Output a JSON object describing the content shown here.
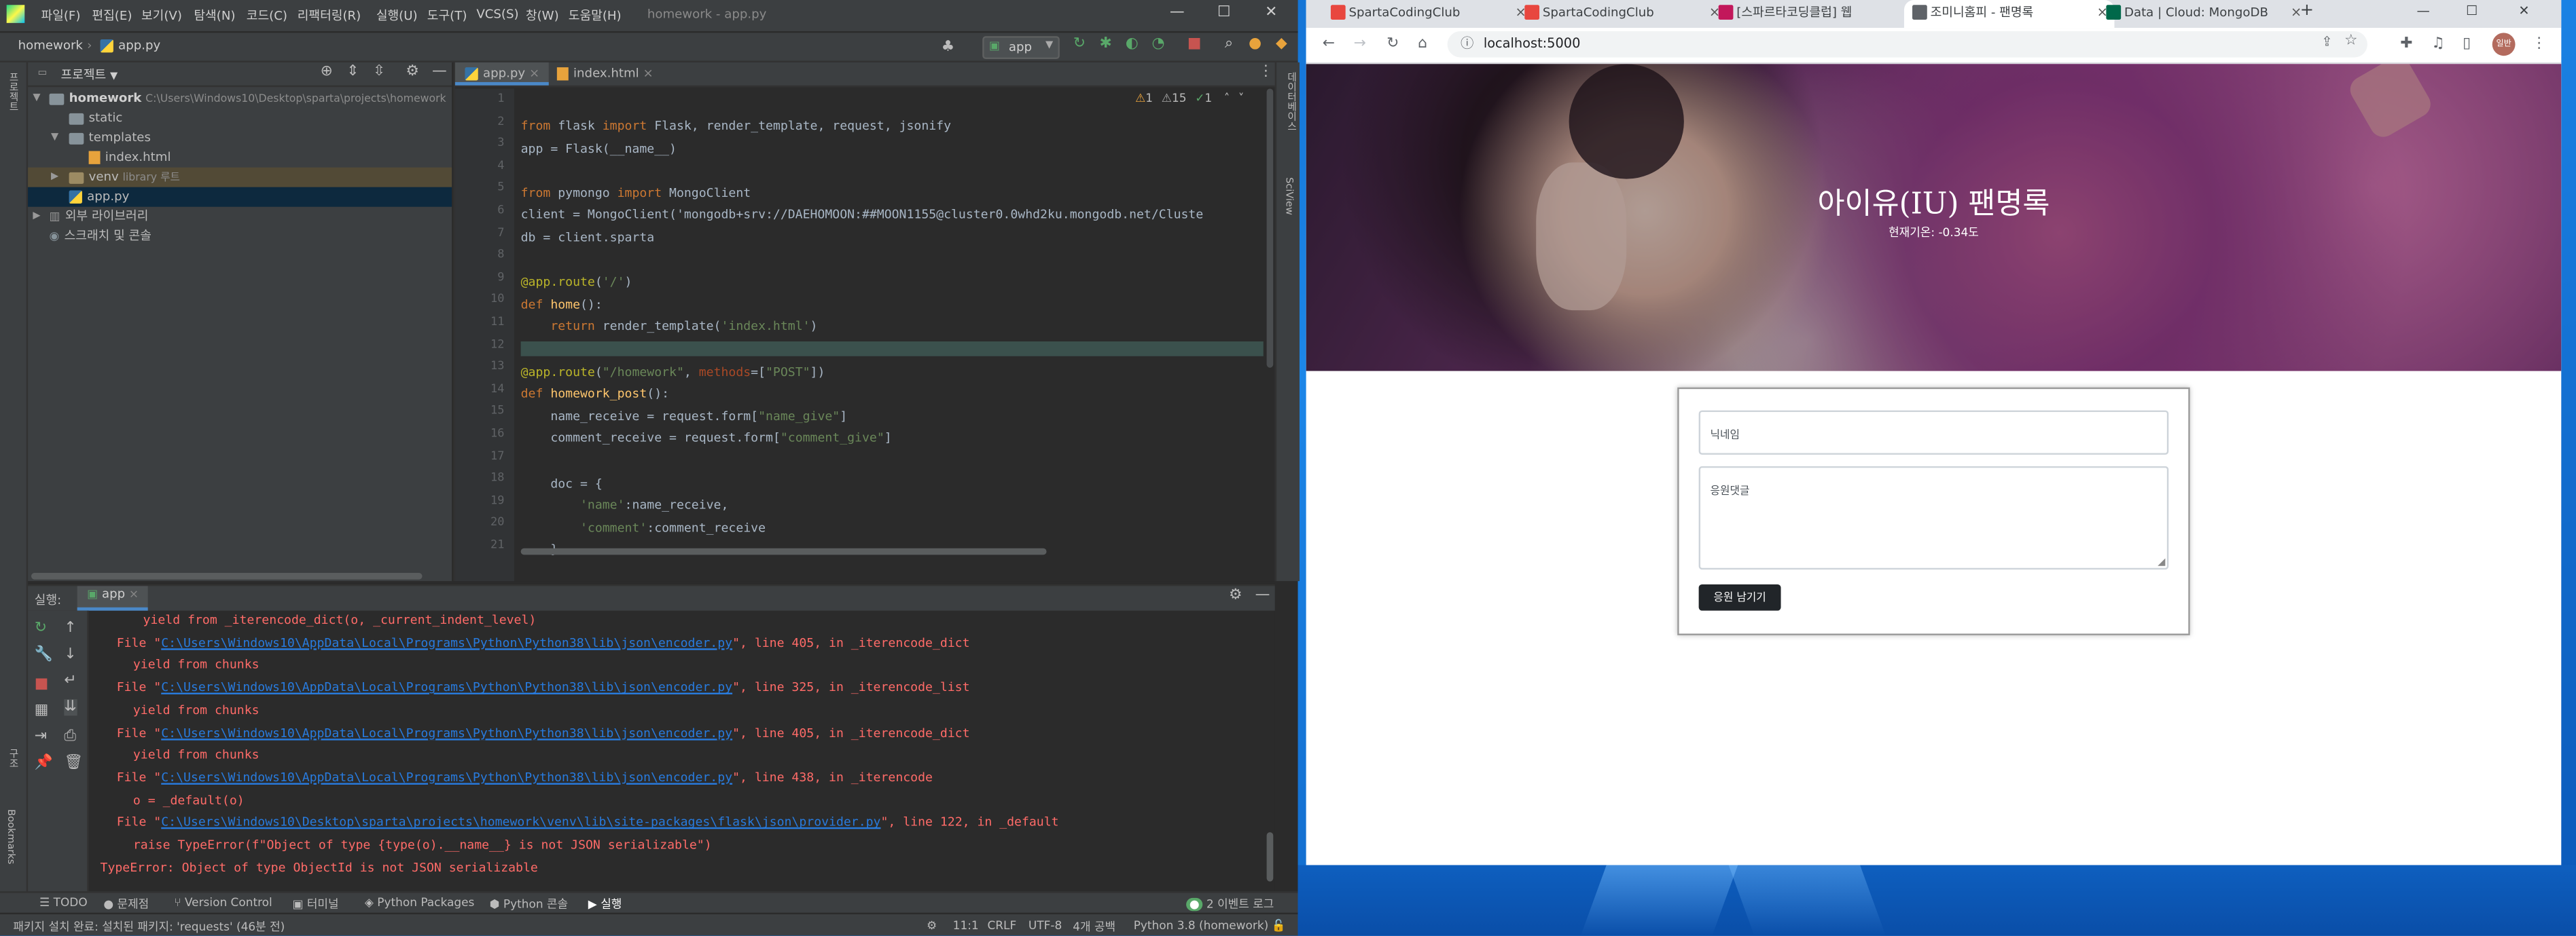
{
  "ide": {
    "title": "homework - app.py",
    "menu": [
      "파일(F)",
      "편집(E)",
      "보기(V)",
      "탐색(N)",
      "코드(C)",
      "리팩터링(R)",
      "실행(U)",
      "도구(T)",
      "VCS(S)",
      "창(W)",
      "도움말(H)"
    ],
    "breadcrumb": [
      "homework",
      "app.py"
    ],
    "run_config": "app",
    "project": {
      "header": "프로젝트",
      "tree": [
        {
          "label": "homework",
          "path": "C:\\Users\\Windows10\\Desktop\\sparta\\projects\\homework",
          "kind": "folder",
          "level": 0,
          "expanded": true
        },
        {
          "label": "static",
          "kind": "folder",
          "level": 1
        },
        {
          "label": "templates",
          "kind": "folder",
          "level": 1,
          "expanded": true
        },
        {
          "label": "index.html",
          "kind": "html",
          "level": 2
        },
        {
          "label": "venv",
          "path": "library 루트",
          "kind": "folder",
          "level": 1
        },
        {
          "label": "app.py",
          "kind": "py",
          "level": 1,
          "selected": true
        },
        {
          "label": "외부 라이브러리",
          "kind": "lib",
          "level": 0
        },
        {
          "label": "스크래치 및 콘솔",
          "kind": "scratch",
          "level": 0
        }
      ]
    },
    "left_strip": [
      "프로젝트",
      "구조",
      "Bookmarks"
    ],
    "right_strip": [
      "데이터베이스",
      "SciView"
    ],
    "editor_tabs": [
      "app.py",
      "index.html"
    ],
    "inspections": {
      "warnings": "1",
      "weak": "15",
      "ok": "1"
    },
    "lines": [
      "from flask import Flask, render_template, request, jsonify",
      "app = Flask(__name__)",
      "",
      "from pymongo import MongoClient",
      "client = MongoClient('mongodb+srv://DAEHOMOON:##MOON1155@cluster0.0whd2ku.mongodb.net/Cluste",
      "db = client.sparta",
      "",
      "@app.route('/')",
      "def home():",
      "    return render_template('index.html')",
      "",
      "@app.route(\"/homework\", methods=[\"POST\"])",
      "def homework_post():",
      "    name_receive = request.form[\"name_give\"]",
      "    comment_receive = request.form[\"comment_give\"]",
      "",
      "    doc = {",
      "        'name':name_receive,",
      "        'comment':comment_receive",
      "    }",
      ""
    ],
    "run": {
      "label": "실행:",
      "tab": "app",
      "output": [
        {
          "text": "    yield from _iterencode_dict(o, _current_indent_level)",
          "indent": 2
        },
        {
          "prefix": "File \"",
          "link": "C:\\Users\\Windows10\\AppData\\Local\\Programs\\Python\\Python38\\lib\\json\\encoder.py",
          "suffix": "\", line 405, in _iterencode_dict",
          "indent": 1
        },
        {
          "text": "yield from chunks",
          "indent": 2
        },
        {
          "prefix": "File \"",
          "link": "C:\\Users\\Windows10\\AppData\\Local\\Programs\\Python\\Python38\\lib\\json\\encoder.py",
          "suffix": "\", line 325, in _iterencode_list",
          "indent": 1
        },
        {
          "text": "yield from chunks",
          "indent": 2
        },
        {
          "prefix": "File \"",
          "link": "C:\\Users\\Windows10\\AppData\\Local\\Programs\\Python\\Python38\\lib\\json\\encoder.py",
          "suffix": "\", line 405, in _iterencode_dict",
          "indent": 1
        },
        {
          "text": "yield from chunks",
          "indent": 2
        },
        {
          "prefix": "File \"",
          "link": "C:\\Users\\Windows10\\AppData\\Local\\Programs\\Python\\Python38\\lib\\json\\encoder.py",
          "suffix": "\", line 438, in _iterencode",
          "indent": 1
        },
        {
          "text": "o = _default(o)",
          "indent": 2
        },
        {
          "prefix": "File \"",
          "link": "C:\\Users\\Windows10\\Desktop\\sparta\\projects\\homework\\venv\\lib\\site-packages\\flask\\json\\provider.py",
          "suffix": "\", line 122, in _default",
          "indent": 1
        },
        {
          "text": "raise TypeError(f\"Object of type {type(o).__name__} is not JSON serializable\")",
          "indent": 2
        },
        {
          "text": "TypeError: Object of type ObjectId is not JSON serializable",
          "indent": 0
        }
      ]
    },
    "bottom_tools": [
      "TODO",
      "문제점",
      "Version Control",
      "터미널",
      "Python Packages",
      "Python 콘솔",
      "실행"
    ],
    "event_log": "2 이벤트 로그",
    "status": {
      "message": "패키지 설치 완료: 설치된 패키지: 'requests' (46분 전)",
      "position": "11:1",
      "line_sep": "CRLF",
      "encoding": "UTF-8",
      "indent": "4개 공백",
      "interpreter": "Python 3.8 (homework)"
    }
  },
  "browser": {
    "tabs": [
      {
        "label": "SpartaCodingClub",
        "color": "#e8473f"
      },
      {
        "label": "SpartaCodingClub",
        "color": "#e8473f"
      },
      {
        "label": "[스파르타코딩클럽] 웹",
        "color": "#c2185b"
      },
      {
        "label": "조미니홈피 - 팬명록",
        "color": "#5f6368",
        "active": true
      },
      {
        "label": "Data | Cloud: MongoDB",
        "color": "#00684a"
      }
    ],
    "url": "localhost:5000",
    "profile": "일반",
    "page": {
      "title": "아이유(IU) 팬명록",
      "temperature": "현재기온: -0.34도",
      "nickname_placeholder": "닉네임",
      "comment_placeholder": "응원댓글",
      "submit_label": "응원 남기기"
    }
  }
}
